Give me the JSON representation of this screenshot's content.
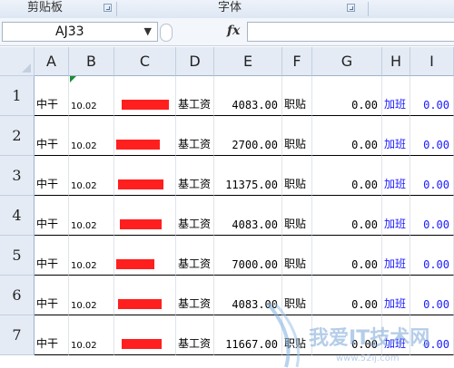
{
  "ribbon": {
    "clipboard_label": "剪贴板",
    "font_label": "字体"
  },
  "formula_bar": {
    "name_box": "AJ33",
    "fx_label": "fx",
    "formula": ""
  },
  "columns": [
    "A",
    "B",
    "C",
    "D",
    "E",
    "F",
    "G",
    "H",
    "I"
  ],
  "rows": [
    {
      "num": "1",
      "a": "中干",
      "b": "10.02",
      "d": "基工资",
      "e": "4083.00",
      "f": "职贴",
      "g": "0.00",
      "h": "加班",
      "i": "0.00"
    },
    {
      "num": "2",
      "a": "中干",
      "b": "10.02",
      "d": "基工资",
      "e": "2700.00",
      "f": "职贴",
      "g": "0.00",
      "h": "加班",
      "i": "0.00"
    },
    {
      "num": "3",
      "a": "中干",
      "b": "10.02",
      "d": "基工资",
      "e": "11375.00",
      "f": "职贴",
      "g": "0.00",
      "h": "加班",
      "i": "0.00"
    },
    {
      "num": "4",
      "a": "中干",
      "b": "10.02",
      "d": "基工资",
      "e": "4083.00",
      "f": "职贴",
      "g": "0.00",
      "h": "加班",
      "i": "0.00"
    },
    {
      "num": "5",
      "a": "中干",
      "b": "10.02",
      "d": "基工资",
      "e": "7000.00",
      "f": "职贴",
      "g": "0.00",
      "h": "加班",
      "i": "0.00"
    },
    {
      "num": "6",
      "a": "中干",
      "b": "10.02",
      "d": "基工资",
      "e": "4083.00",
      "f": "职贴",
      "g": "0.00",
      "h": "加班",
      "i": "0.00"
    },
    {
      "num": "7",
      "a": "中干",
      "b": "10.02",
      "d": "基工资",
      "e": "11667.00",
      "f": "职贴",
      "g": "0.00",
      "h": "加班",
      "i": "0.00"
    }
  ],
  "colors": {
    "redaction": "#ff1f1f",
    "link_blue": "#1a1aff",
    "header_bg": "#e4ebf5"
  }
}
